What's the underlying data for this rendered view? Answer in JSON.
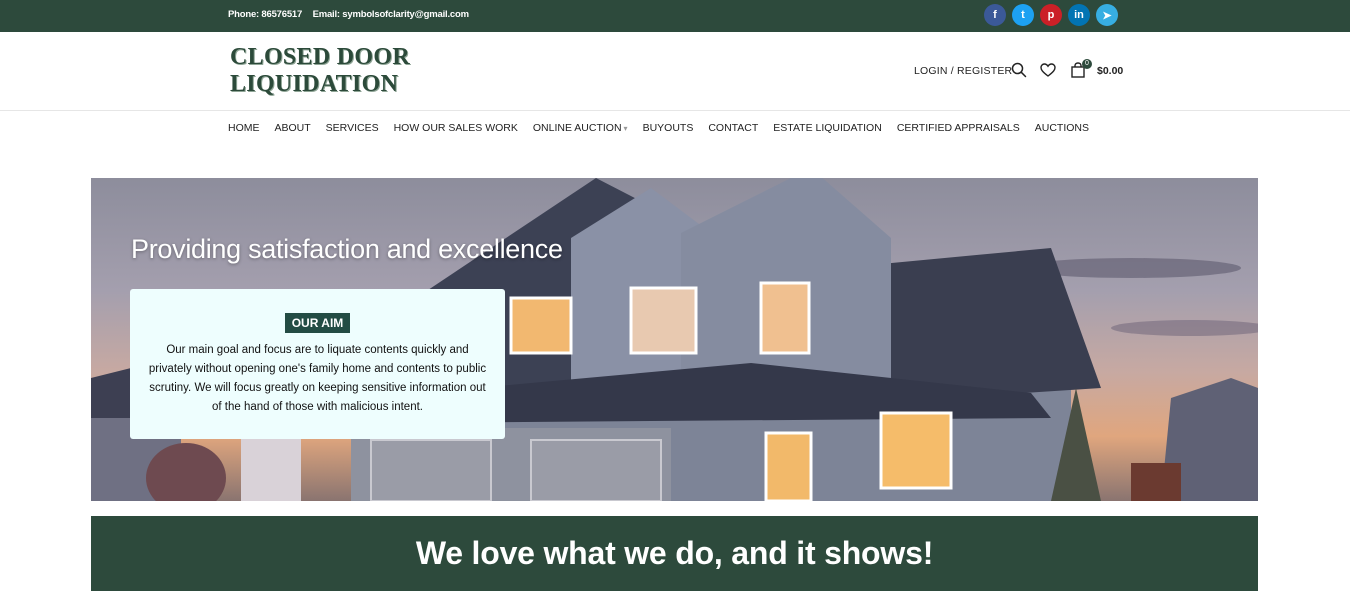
{
  "topbar": {
    "phone": "Phone: 86576517",
    "email": "Email: symbolsofclarity@gmail.com",
    "social": [
      {
        "name": "facebook-icon",
        "glyph": "f",
        "color": "#3b5998"
      },
      {
        "name": "twitter-icon",
        "glyph": "t",
        "color": "#1da1f2"
      },
      {
        "name": "pinterest-icon",
        "glyph": "p",
        "color": "#cb2027"
      },
      {
        "name": "linkedin-icon",
        "glyph": "in",
        "color": "#0274b3"
      },
      {
        "name": "telegram-icon",
        "glyph": "➤",
        "color": "#37aee2"
      }
    ]
  },
  "header": {
    "logo_line1": "CLOSED DOOR",
    "logo_line2": "LIQUIDATION",
    "login": "LOGIN / REGISTER",
    "cart_count": "0",
    "cart_total": "$0.00"
  },
  "nav": {
    "items": [
      "HOME",
      "ABOUT",
      "SERVICES",
      "HOW OUR SALES WORK",
      "ONLINE AUCTION",
      "BUYOUTS",
      "CONTACT",
      "ESTATE LIQUIDATION",
      "CERTIFIED APPRAISALS",
      "AUCTIONS"
    ]
  },
  "hero": {
    "title": "Providing satisfaction and excellence",
    "badge": "OUR AIM",
    "text": "Our main goal and focus are to liquate contents quickly and privately without opening one's family home and contents to public scrutiny. We will focus greatly on keeping sensitive information out of the hand of those with malicious intent."
  },
  "banner": {
    "text": "We love what we do, and it shows!"
  },
  "colors": {
    "brand_green": "#2d4a3c",
    "badge_green": "#234c44"
  }
}
